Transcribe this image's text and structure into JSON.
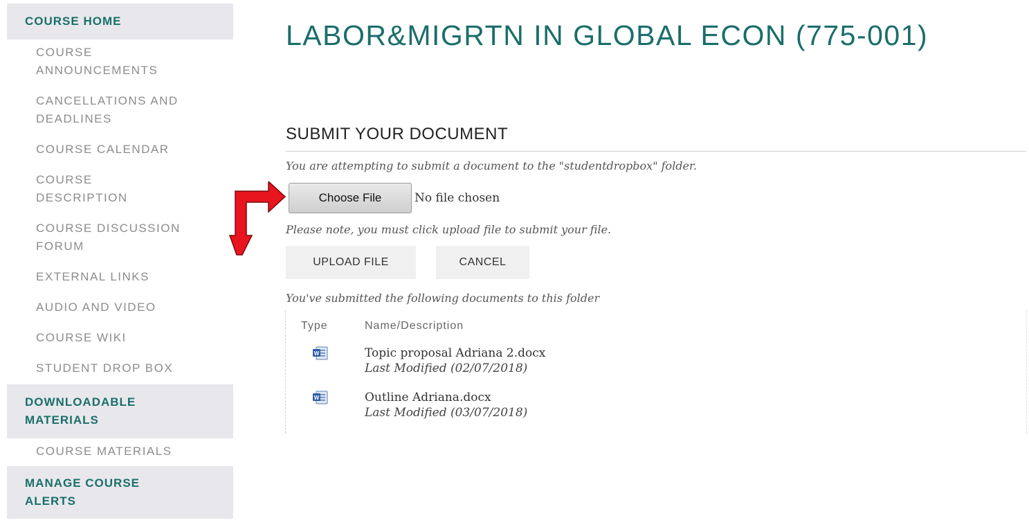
{
  "sidebar": {
    "sections": [
      {
        "lines": [
          "COURSE HOME"
        ]
      },
      {
        "lines": [
          "DOWNLOADABLE",
          "MATERIALS"
        ]
      },
      {
        "lines": [
          "MANAGE COURSE",
          "ALERTS"
        ]
      }
    ],
    "items": [
      {
        "lines": [
          "COURSE",
          "ANNOUNCEMENTS"
        ]
      },
      {
        "lines": [
          "CANCELLATIONS AND",
          "DEADLINES"
        ]
      },
      {
        "lines": [
          "COURSE CALENDAR"
        ]
      },
      {
        "lines": [
          "COURSE",
          "DESCRIPTION"
        ]
      },
      {
        "lines": [
          "COURSE DISCUSSION",
          "FORUM"
        ]
      },
      {
        "lines": [
          "EXTERNAL LINKS"
        ]
      },
      {
        "lines": [
          "AUDIO AND VIDEO"
        ]
      },
      {
        "lines": [
          "COURSE WIKI"
        ]
      },
      {
        "lines": [
          "STUDENT DROP BOX"
        ]
      },
      {
        "lines": [
          "COURSE MATERIALS"
        ]
      }
    ]
  },
  "main": {
    "title": "LABOR&MIGRTN IN GLOBAL ECON (775-001)",
    "section_title": "SUBMIT YOUR DOCUMENT",
    "attempt_note": "You are attempting to submit a document to the \"studentdropbox\" folder.",
    "choose_file_label": "Choose File",
    "file_status": "No file chosen",
    "upload_note": "Please note, you must click upload file to submit your file.",
    "upload_label": "UPLOAD FILE",
    "cancel_label": "CANCEL",
    "submitted_note": "You've submitted the following documents to this folder",
    "table": {
      "headers": {
        "type": "Type",
        "name": "Name/Description"
      },
      "rows": [
        {
          "icon": "word-document-icon",
          "name": "Topic proposal Adriana 2.docx",
          "modified": "Last Modified (02/07/2018)"
        },
        {
          "icon": "word-document-icon",
          "name": "Outline Adriana.docx",
          "modified": "Last Modified (03/07/2018)"
        }
      ]
    }
  },
  "colors": {
    "accent_teal": "#1a6e6a",
    "arrow_red": "#e8141e",
    "sidebar_section_bg": "#e8e8ec"
  }
}
